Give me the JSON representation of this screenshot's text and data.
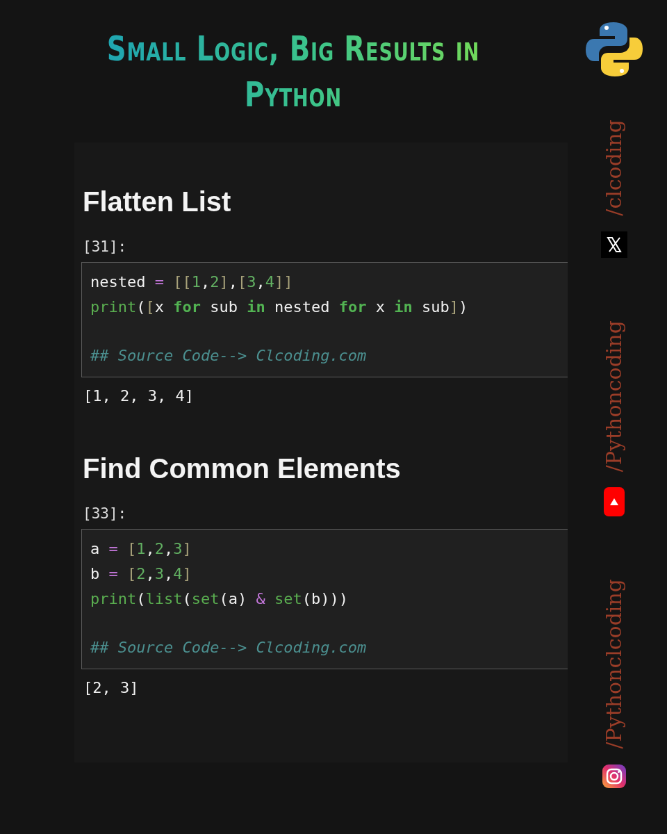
{
  "title": "Small Logic, Big Results in Python",
  "cells": [
    {
      "heading": "Flatten List",
      "prompt": "[31]:",
      "lines": [
        [
          {
            "kind": "plain",
            "text": "nested "
          },
          {
            "kind": "op",
            "text": "= "
          },
          {
            "kind": "bracket",
            "text": "[["
          },
          {
            "kind": "number",
            "text": "1"
          },
          {
            "kind": "plain",
            "text": ","
          },
          {
            "kind": "number",
            "text": "2"
          },
          {
            "kind": "bracket",
            "text": "]"
          },
          {
            "kind": "plain",
            "text": ","
          },
          {
            "kind": "bracket",
            "text": "["
          },
          {
            "kind": "number",
            "text": "3"
          },
          {
            "kind": "plain",
            "text": ","
          },
          {
            "kind": "number",
            "text": "4"
          },
          {
            "kind": "bracket",
            "text": "]]"
          }
        ],
        [
          {
            "kind": "builtin",
            "text": "print"
          },
          {
            "kind": "plain",
            "text": "("
          },
          {
            "kind": "bracket",
            "text": "["
          },
          {
            "kind": "plain",
            "text": "x "
          },
          {
            "kind": "keyword",
            "text": "for"
          },
          {
            "kind": "plain",
            "text": " sub "
          },
          {
            "kind": "keyword",
            "text": "in"
          },
          {
            "kind": "plain",
            "text": " nested "
          },
          {
            "kind": "keyword",
            "text": "for"
          },
          {
            "kind": "plain",
            "text": " x "
          },
          {
            "kind": "keyword",
            "text": "in"
          },
          {
            "kind": "plain",
            "text": " sub"
          },
          {
            "kind": "bracket",
            "text": "]"
          },
          {
            "kind": "plain",
            "text": ")"
          }
        ]
      ],
      "comment": "## Source Code--> Clcoding.com",
      "output": "[1, 2, 3, 4]"
    },
    {
      "heading": "Find Common Elements",
      "prompt": "[33]:",
      "lines": [
        [
          {
            "kind": "plain",
            "text": "a "
          },
          {
            "kind": "op",
            "text": "= "
          },
          {
            "kind": "bracket",
            "text": "["
          },
          {
            "kind": "number",
            "text": "1"
          },
          {
            "kind": "plain",
            "text": ","
          },
          {
            "kind": "number",
            "text": "2"
          },
          {
            "kind": "plain",
            "text": ","
          },
          {
            "kind": "number",
            "text": "3"
          },
          {
            "kind": "bracket",
            "text": "]"
          }
        ],
        [
          {
            "kind": "plain",
            "text": "b "
          },
          {
            "kind": "op",
            "text": "= "
          },
          {
            "kind": "bracket",
            "text": "["
          },
          {
            "kind": "number",
            "text": "2"
          },
          {
            "kind": "plain",
            "text": ","
          },
          {
            "kind": "number",
            "text": "3"
          },
          {
            "kind": "plain",
            "text": ","
          },
          {
            "kind": "number",
            "text": "4"
          },
          {
            "kind": "bracket",
            "text": "]"
          }
        ],
        [
          {
            "kind": "builtin",
            "text": "print"
          },
          {
            "kind": "plain",
            "text": "("
          },
          {
            "kind": "builtin",
            "text": "list"
          },
          {
            "kind": "plain",
            "text": "("
          },
          {
            "kind": "builtin",
            "text": "set"
          },
          {
            "kind": "plain",
            "text": "(a) "
          },
          {
            "kind": "op",
            "text": "& "
          },
          {
            "kind": "builtin",
            "text": "set"
          },
          {
            "kind": "plain",
            "text": "(b)))"
          }
        ]
      ],
      "comment": "## Source Code--> Clcoding.com",
      "output": "[2, 3]"
    }
  ],
  "socials": [
    {
      "handle": "/clcoding",
      "kind": "x"
    },
    {
      "handle": "/Pythoncoding",
      "kind": "youtube"
    },
    {
      "handle": "/Pythonclcoding",
      "kind": "instagram"
    }
  ]
}
